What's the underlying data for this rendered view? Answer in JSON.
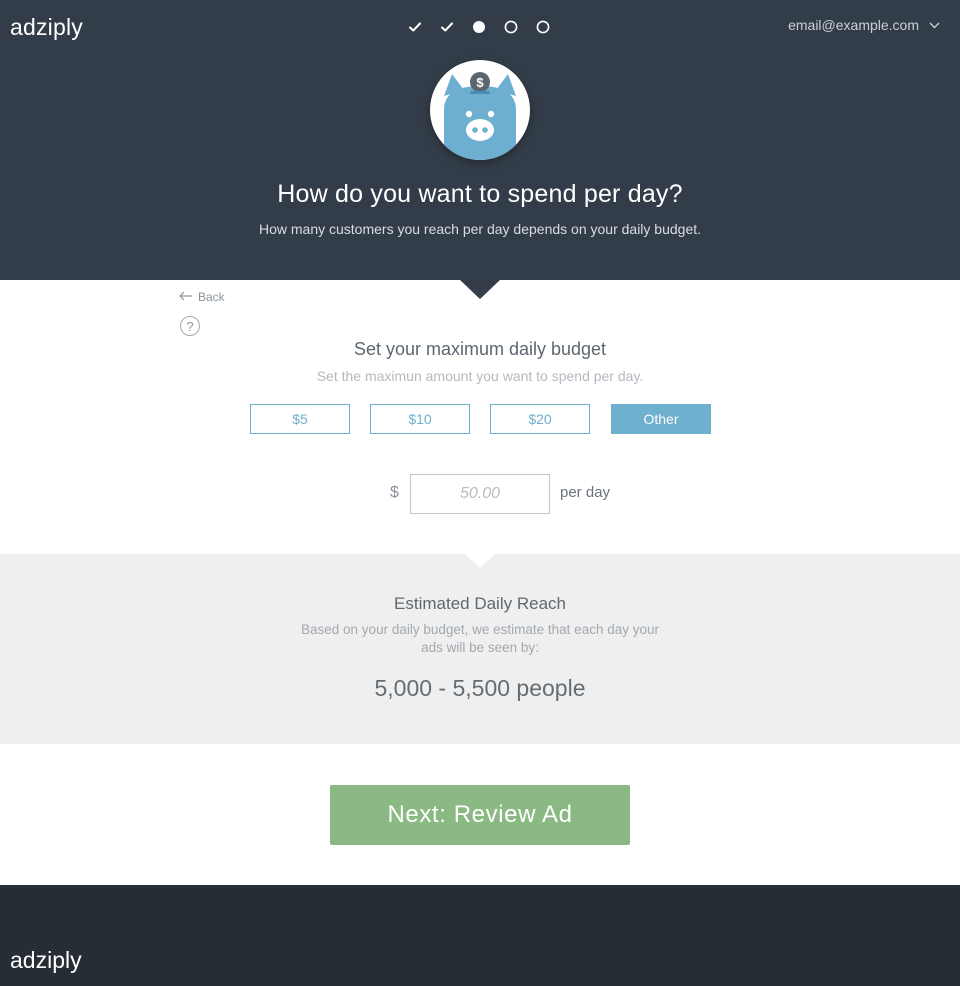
{
  "brand": {
    "name": "adziply"
  },
  "progress": {
    "steps": [
      {
        "state": "completed",
        "icon": "check-icon"
      },
      {
        "state": "completed",
        "icon": "check-icon"
      },
      {
        "state": "current",
        "icon": "filled-dot-icon"
      },
      {
        "state": "upcoming",
        "icon": "empty-circle-icon"
      },
      {
        "state": "upcoming",
        "icon": "empty-circle-icon"
      }
    ]
  },
  "account": {
    "email": "email@example.com",
    "menu_icon": "chevron-down-icon"
  },
  "hero": {
    "icon": "piggy-bank-icon",
    "title": "How do you want to spend per day?",
    "subtitle": "How many customers you reach per day depends on your daily budget."
  },
  "nav": {
    "back_label": "Back",
    "help_label": "?"
  },
  "budget": {
    "title": "Set your maximum daily budget",
    "subtitle": "Set the maximun amount you want to spend per day.",
    "options": [
      {
        "label": "$5",
        "selected": false
      },
      {
        "label": "$10",
        "selected": false
      },
      {
        "label": "$20",
        "selected": false
      },
      {
        "label": "Other",
        "selected": true
      }
    ],
    "currency_symbol": "$",
    "amount_value": "",
    "amount_placeholder": "50.00",
    "unit_label": "per day"
  },
  "reach": {
    "title": "Estimated Daily Reach",
    "description": "Based on your daily budget, we estimate that each day your ads will be seen by:",
    "value": "5,000 - 5,500 people"
  },
  "next_button": {
    "label": "Next: Review Ad"
  },
  "footer": {
    "brand": "adziply"
  },
  "colors": {
    "header_bg": "#333d49",
    "accent_blue": "#6fb0cf",
    "next_green": "#8bb983",
    "reach_bg": "#efefef",
    "footer_bg": "#262d35"
  }
}
